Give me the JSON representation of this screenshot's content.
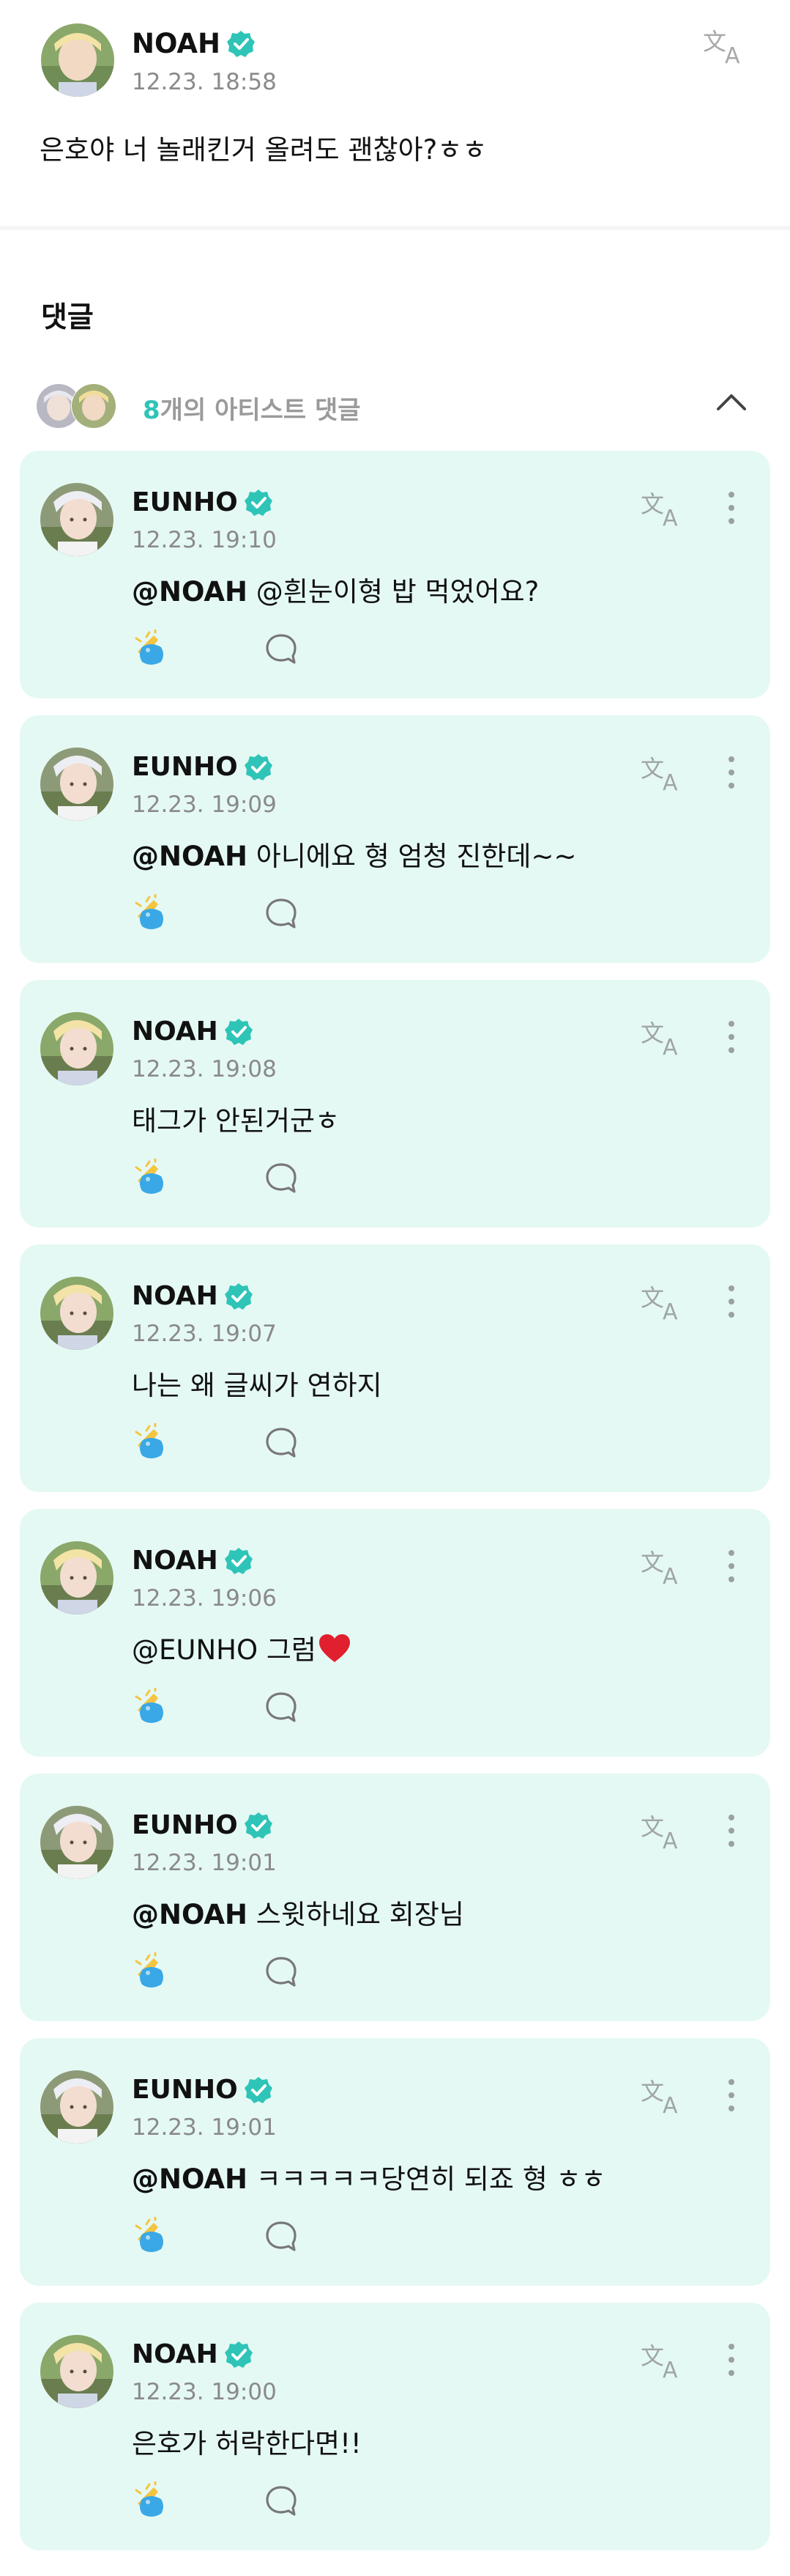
{
  "post": {
    "author": "NOAH",
    "date": "12.23. 18:58",
    "text": "은호야 너 놀래킨거 올려도 괜찮아?ㅎㅎ"
  },
  "comments_section": {
    "title": "댓글",
    "artist_count": "8",
    "artist_label": "개의 아티스트 댓글"
  },
  "comments": [
    {
      "author": "EUNHO",
      "date": "12.23. 19:10",
      "mention": "@NOAH",
      "text": " @흰눈이형 밥 먹었어요?"
    },
    {
      "author": "EUNHO",
      "date": "12.23. 19:09",
      "mention": "@NOAH",
      "text": " 아니에요 형 엄청 진한데~~"
    },
    {
      "author": "NOAH",
      "date": "12.23. 19:08",
      "mention": "",
      "text": "태그가 안된거군ㅎ"
    },
    {
      "author": "NOAH",
      "date": "12.23. 19:07",
      "mention": "",
      "text": "나는 왜 글씨가 연하지"
    },
    {
      "author": "NOAH",
      "date": "12.23. 19:06",
      "mention": "",
      "text": "@EUNHO 그럼"
    },
    {
      "author": "EUNHO",
      "date": "12.23. 19:01",
      "mention": "@NOAH",
      "text": " 스윗하네요 회장님"
    },
    {
      "author": "EUNHO",
      "date": "12.23. 19:01",
      "mention": "@NOAH",
      "text": " ㅋㅋㅋㅋㅋ당연히 되죠 형 ㅎㅎ"
    },
    {
      "author": "NOAH",
      "date": "12.23. 19:00",
      "mention": "",
      "text": "은호가 허락한다면!!"
    }
  ],
  "icons": {
    "verified": "verified-badge-icon",
    "translate": "translate-icon",
    "more": "more-vertical-icon",
    "cheer": "cheer-icon",
    "reply": "reply-bubble-icon",
    "collapse": "chevron-up-icon",
    "heart": "heart-emoji-icon"
  },
  "colors": {
    "card_background": "#e5f9f4",
    "accent": "#2fc4b8",
    "muted_text": "#8a8a8a"
  }
}
